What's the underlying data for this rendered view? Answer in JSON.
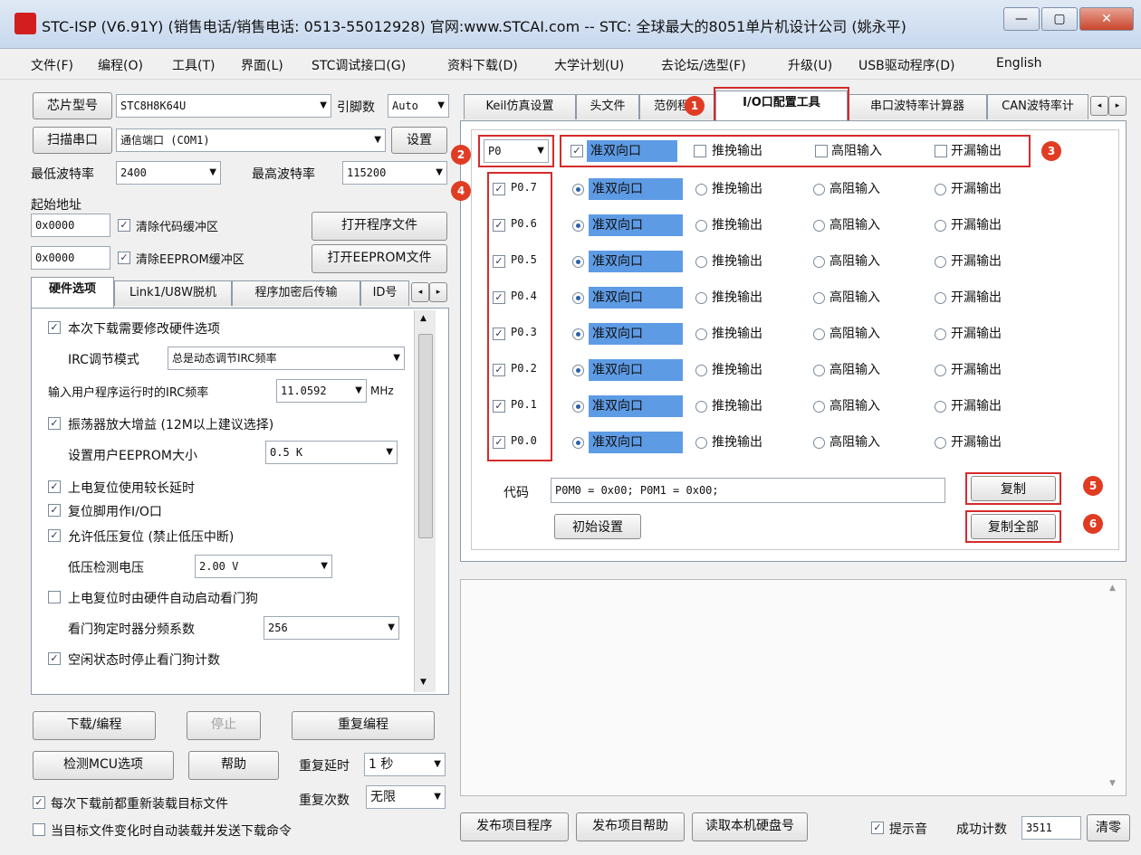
{
  "window": {
    "title": "STC-ISP (V6.91Y) (销售电话/销售电话: 0513-55012928) 官网:www.STCAI.com  -- STC: 全球最大的8051单片机设计公司 (姚永平)",
    "min_label": "—",
    "max_label": "▢",
    "close_label": "✕"
  },
  "menu": [
    "文件(F)",
    "编程(O)",
    "工具(T)",
    "界面(L)",
    "STC调试接口(G)",
    "资料下载(D)",
    "大学计划(U)",
    "去论坛/选型(F)",
    "升级(U)",
    "USB驱动程序(D)",
    "English"
  ],
  "left": {
    "chip_btn": "芯片型号",
    "chip_value": "STC8H8K64U",
    "pins_label": "引脚数",
    "pins_value": "Auto",
    "scan_btn": "扫描串口",
    "port_value": "通信端口 (COM1)",
    "settings_btn": "设置",
    "min_baud_label": "最低波特率",
    "min_baud_value": "2400",
    "max_baud_label": "最高波特率",
    "max_baud_value": "115200",
    "start_addr_label": "起始地址",
    "addr1": "0x0000",
    "clear_code_label": "清除代码缓冲区",
    "open_prog_btn": "打开程序文件",
    "addr2": "0x0000",
    "clear_eeprom_label": "清除EEPROM缓冲区",
    "open_eeprom_btn": "打开EEPROM文件",
    "tabs": [
      "硬件选项",
      "Link1/U8W脱机",
      "程序加密后传输",
      "ID号"
    ],
    "options": {
      "opt1": "本次下载需要修改硬件选项",
      "irc_mode_label": "IRC调节模式",
      "irc_mode_value": "总是动态调节IRC频率",
      "freq_label": "输入用户程序运行时的IRC频率",
      "freq_value": "11.0592",
      "freq_unit": "MHz",
      "opt2": "振荡器放大增益 (12M以上建议选择)",
      "eeprom_label": "设置用户EEPROM大小",
      "eeprom_value": "0.5 K",
      "opt3": "上电复位使用较长延时",
      "opt4": "复位脚用作I/O口",
      "opt5": "允许低压复位 (禁止低压中断)",
      "lvd_label": "低压检测电压",
      "lvd_value": "2.00 V",
      "opt6": "上电复位时由硬件自动启动看门狗",
      "wdt_label": "看门狗定时器分频系数",
      "wdt_value": "256",
      "opt7": "空闲状态时停止看门狗计数"
    },
    "download_btn": "下载/编程",
    "stop_btn": "停止",
    "reprogram_btn": "重复编程",
    "check_btn": "检测MCU选项",
    "help_btn": "帮助",
    "delay_label": "重复延时",
    "delay_value": "1 秒",
    "count_label": "重复次数",
    "count_value": "无限",
    "reload_label": "每次下载前都重新装载目标文件",
    "auto_label": "当目标文件变化时自动装载并发送下载命令"
  },
  "right": {
    "tabs": [
      "Keil仿真设置",
      "头文件",
      "范例程序",
      "I/O口配置工具",
      "串口波特率计算器",
      "CAN波特率计"
    ],
    "port_select": "P0",
    "header_opts": [
      "准双向口",
      "推挽输出",
      "高阻输入",
      "开漏输出"
    ],
    "pins": [
      {
        "label": "P0.7",
        "checked": true,
        "mode": 0
      },
      {
        "label": "P0.6",
        "checked": true,
        "mode": 0
      },
      {
        "label": "P0.5",
        "checked": true,
        "mode": 0
      },
      {
        "label": "P0.4",
        "checked": true,
        "mode": 0
      },
      {
        "label": "P0.3",
        "checked": true,
        "mode": 0
      },
      {
        "label": "P0.2",
        "checked": true,
        "mode": 0
      },
      {
        "label": "P0.1",
        "checked": true,
        "mode": 0
      },
      {
        "label": "P0.0",
        "checked": true,
        "mode": 0
      }
    ],
    "code_label": "代码",
    "code_value": "P0M0 = 0x00; P0M1 = 0x00;",
    "copy_btn": "复制",
    "reset_btn": "初始设置",
    "copy_all_btn": "复制全部",
    "badges": [
      "1",
      "2",
      "3",
      "4",
      "5",
      "6"
    ],
    "publish_btn": "发布项目程序",
    "publish_help_btn": "发布项目帮助",
    "read_disk_btn": "读取本机硬盘号",
    "hint_label": "提示音",
    "success_label": "成功计数",
    "success_value": "3511",
    "clear_btn": "清零"
  },
  "colors": {
    "highlight": "#d42b2b",
    "badge": "#e03c24",
    "selected": "#5e9be5"
  }
}
